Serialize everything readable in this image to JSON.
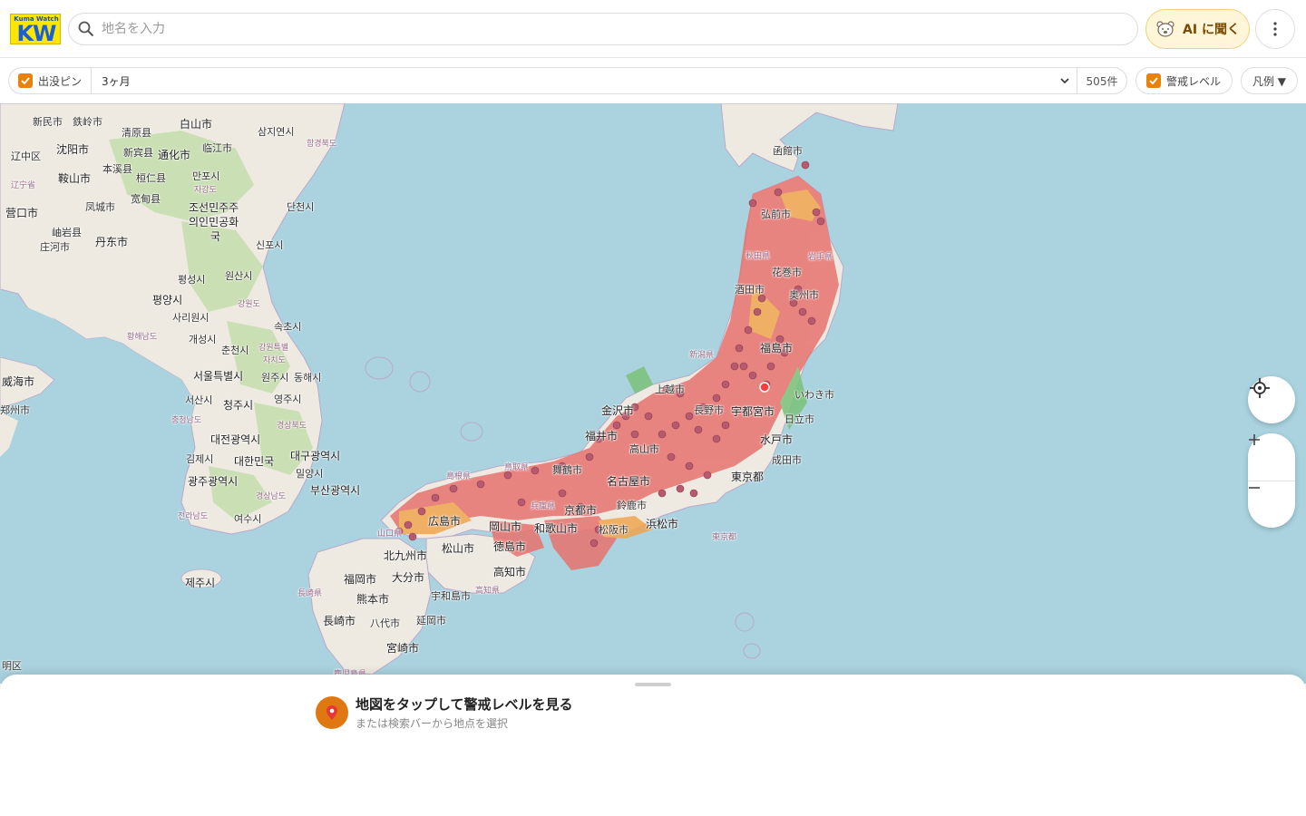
{
  "header": {
    "logo_top": "Kuma Watch",
    "logo_main": "KW",
    "search_placeholder": "地名を入力",
    "ai_button_label": "AI に聞く"
  },
  "filters": {
    "pins_label": "出没ピン",
    "pins_checked": true,
    "period_value": "3ヶ月",
    "count": "505件",
    "alert_label": "警戒レベル",
    "alert_checked": true,
    "legend_label": "凡例 ▼"
  },
  "map": {
    "labels": [
      {
        "text": "新民市",
        "cls": ""
      },
      {
        "text": "鉄岭市",
        "cls": ""
      },
      {
        "text": "白山市",
        "cls": "city-lg"
      },
      {
        "text": "沈阳市",
        "cls": "city-lg"
      },
      {
        "text": "清原县",
        "cls": ""
      },
      {
        "text": "临江市",
        "cls": ""
      },
      {
        "text": "辽中区",
        "cls": ""
      },
      {
        "text": "本溪县",
        "cls": ""
      },
      {
        "text": "新宾县",
        "cls": ""
      },
      {
        "text": "通化市",
        "cls": "city-lg"
      },
      {
        "text": "鞍山市",
        "cls": "city-lg"
      },
      {
        "text": "桓仁县",
        "cls": ""
      },
      {
        "text": "辽宁省",
        "cls": "pref"
      },
      {
        "text": "宽甸县",
        "cls": ""
      },
      {
        "text": "营口市",
        "cls": "city-lg"
      },
      {
        "text": "凤城市",
        "cls": ""
      },
      {
        "text": "岫岩县",
        "cls": ""
      },
      {
        "text": "丹东市",
        "cls": "city-lg"
      },
      {
        "text": "庄河市",
        "cls": ""
      },
      {
        "text": "조선민주주",
        "cls": "city-lg"
      },
      {
        "text": "의인민공화",
        "cls": "city-lg"
      },
      {
        "text": "국",
        "cls": "city-lg"
      },
      {
        "text": "삼지연시",
        "cls": ""
      },
      {
        "text": "함경북도",
        "cls": "pref"
      },
      {
        "text": "만포시",
        "cls": ""
      },
      {
        "text": "자강도",
        "cls": "pref"
      },
      {
        "text": "단천시",
        "cls": ""
      },
      {
        "text": "신포시",
        "cls": ""
      },
      {
        "text": "평양시",
        "cls": "city-lg"
      },
      {
        "text": "평성시",
        "cls": ""
      },
      {
        "text": "원산시",
        "cls": ""
      },
      {
        "text": "사리원시",
        "cls": ""
      },
      {
        "text": "강원도",
        "cls": "pref"
      },
      {
        "text": "황해남도",
        "cls": "pref"
      },
      {
        "text": "개성시",
        "cls": ""
      },
      {
        "text": "속초시",
        "cls": ""
      },
      {
        "text": "춘천시",
        "cls": ""
      },
      {
        "text": "강원특별",
        "cls": "pref"
      },
      {
        "text": "자치도",
        "cls": "pref"
      },
      {
        "text": "서울특별시",
        "cls": "city-lg"
      },
      {
        "text": "원주시",
        "cls": ""
      },
      {
        "text": "동해시",
        "cls": ""
      },
      {
        "text": "威海市",
        "cls": "city-lg"
      },
      {
        "text": "서산시",
        "cls": ""
      },
      {
        "text": "청주시",
        "cls": "city-lg"
      },
      {
        "text": "영주시",
        "cls": ""
      },
      {
        "text": "충청남도",
        "cls": "pref"
      },
      {
        "text": "경상북도",
        "cls": "pref"
      },
      {
        "text": "대전광역시",
        "cls": "city-lg"
      },
      {
        "text": "대구광역시",
        "cls": "city-lg"
      },
      {
        "text": "김제시",
        "cls": ""
      },
      {
        "text": "대한민국",
        "cls": "city-lg"
      },
      {
        "text": "밀양시",
        "cls": ""
      },
      {
        "text": "광주광역시",
        "cls": "city-lg"
      },
      {
        "text": "부산광역시",
        "cls": "city-lg"
      },
      {
        "text": "경상남도",
        "cls": "pref"
      },
      {
        "text": "전라남도",
        "cls": "pref"
      },
      {
        "text": "여수시",
        "cls": ""
      },
      {
        "text": "제주시",
        "cls": "city-lg"
      },
      {
        "text": "函館市",
        "cls": ""
      },
      {
        "text": "弘前市",
        "cls": ""
      },
      {
        "text": "秋田県",
        "cls": "pref"
      },
      {
        "text": "岩手県",
        "cls": "pref"
      },
      {
        "text": "花巻市",
        "cls": ""
      },
      {
        "text": "酒田市",
        "cls": ""
      },
      {
        "text": "奥州市",
        "cls": ""
      },
      {
        "text": "福島市",
        "cls": "city-lg"
      },
      {
        "text": "新潟県",
        "cls": "pref"
      },
      {
        "text": "いわき市",
        "cls": ""
      },
      {
        "text": "上越市",
        "cls": ""
      },
      {
        "text": "長野市",
        "cls": ""
      },
      {
        "text": "宇都宮市",
        "cls": "city-lg"
      },
      {
        "text": "日立市",
        "cls": ""
      },
      {
        "text": "金沢市",
        "cls": "city-lg"
      },
      {
        "text": "福井市",
        "cls": "city-lg"
      },
      {
        "text": "高山市",
        "cls": ""
      },
      {
        "text": "水戸市",
        "cls": "city-lg"
      },
      {
        "text": "成田市",
        "cls": ""
      },
      {
        "text": "東京都",
        "cls": "city-lg"
      },
      {
        "text": "名古屋市",
        "cls": "city-lg"
      },
      {
        "text": "鳥取県",
        "cls": "pref"
      },
      {
        "text": "舞鶴市",
        "cls": ""
      },
      {
        "text": "島根県",
        "cls": "pref"
      },
      {
        "text": "京都市",
        "cls": "city-lg"
      },
      {
        "text": "兵庫県",
        "cls": "pref"
      },
      {
        "text": "鈴鹿市",
        "cls": ""
      },
      {
        "text": "浜松市",
        "cls": "city-lg"
      },
      {
        "text": "広島市",
        "cls": "city-lg"
      },
      {
        "text": "岡山市",
        "cls": "city-lg"
      },
      {
        "text": "和歌山市",
        "cls": "city-lg"
      },
      {
        "text": "松阪市",
        "cls": ""
      },
      {
        "text": "山口県",
        "cls": "pref"
      },
      {
        "text": "東京都",
        "cls": "pref"
      },
      {
        "text": "北九州市",
        "cls": "city-lg"
      },
      {
        "text": "松山市",
        "cls": "city-lg"
      },
      {
        "text": "徳島市",
        "cls": "city-lg"
      },
      {
        "text": "福岡市",
        "cls": "city-lg"
      },
      {
        "text": "大分市",
        "cls": "city-lg"
      },
      {
        "text": "高知市",
        "cls": "city-lg"
      },
      {
        "text": "長崎県",
        "cls": "pref"
      },
      {
        "text": "熊本市",
        "cls": "city-lg"
      },
      {
        "text": "宇和島市",
        "cls": ""
      },
      {
        "text": "高知県",
        "cls": "pref"
      },
      {
        "text": "長崎市",
        "cls": "city-lg"
      },
      {
        "text": "八代市",
        "cls": ""
      },
      {
        "text": "延岡市",
        "cls": ""
      },
      {
        "text": "宮崎市",
        "cls": "city-lg"
      },
      {
        "text": "鹿児島県",
        "cls": "pref"
      },
      {
        "text": "明区",
        "cls": ""
      },
      {
        "text": "郑州市",
        "cls": ""
      }
    ]
  },
  "sheet": {
    "title": "地図をタップして警戒レベルを見る",
    "subtitle": "または検索バーから地点を選択"
  },
  "colors": {
    "accent": "#e07812",
    "alert_high": "#e8736e",
    "alert_mid": "#f0a550",
    "alert_low": "#7cc27a",
    "pin": "#b85a6e"
  }
}
